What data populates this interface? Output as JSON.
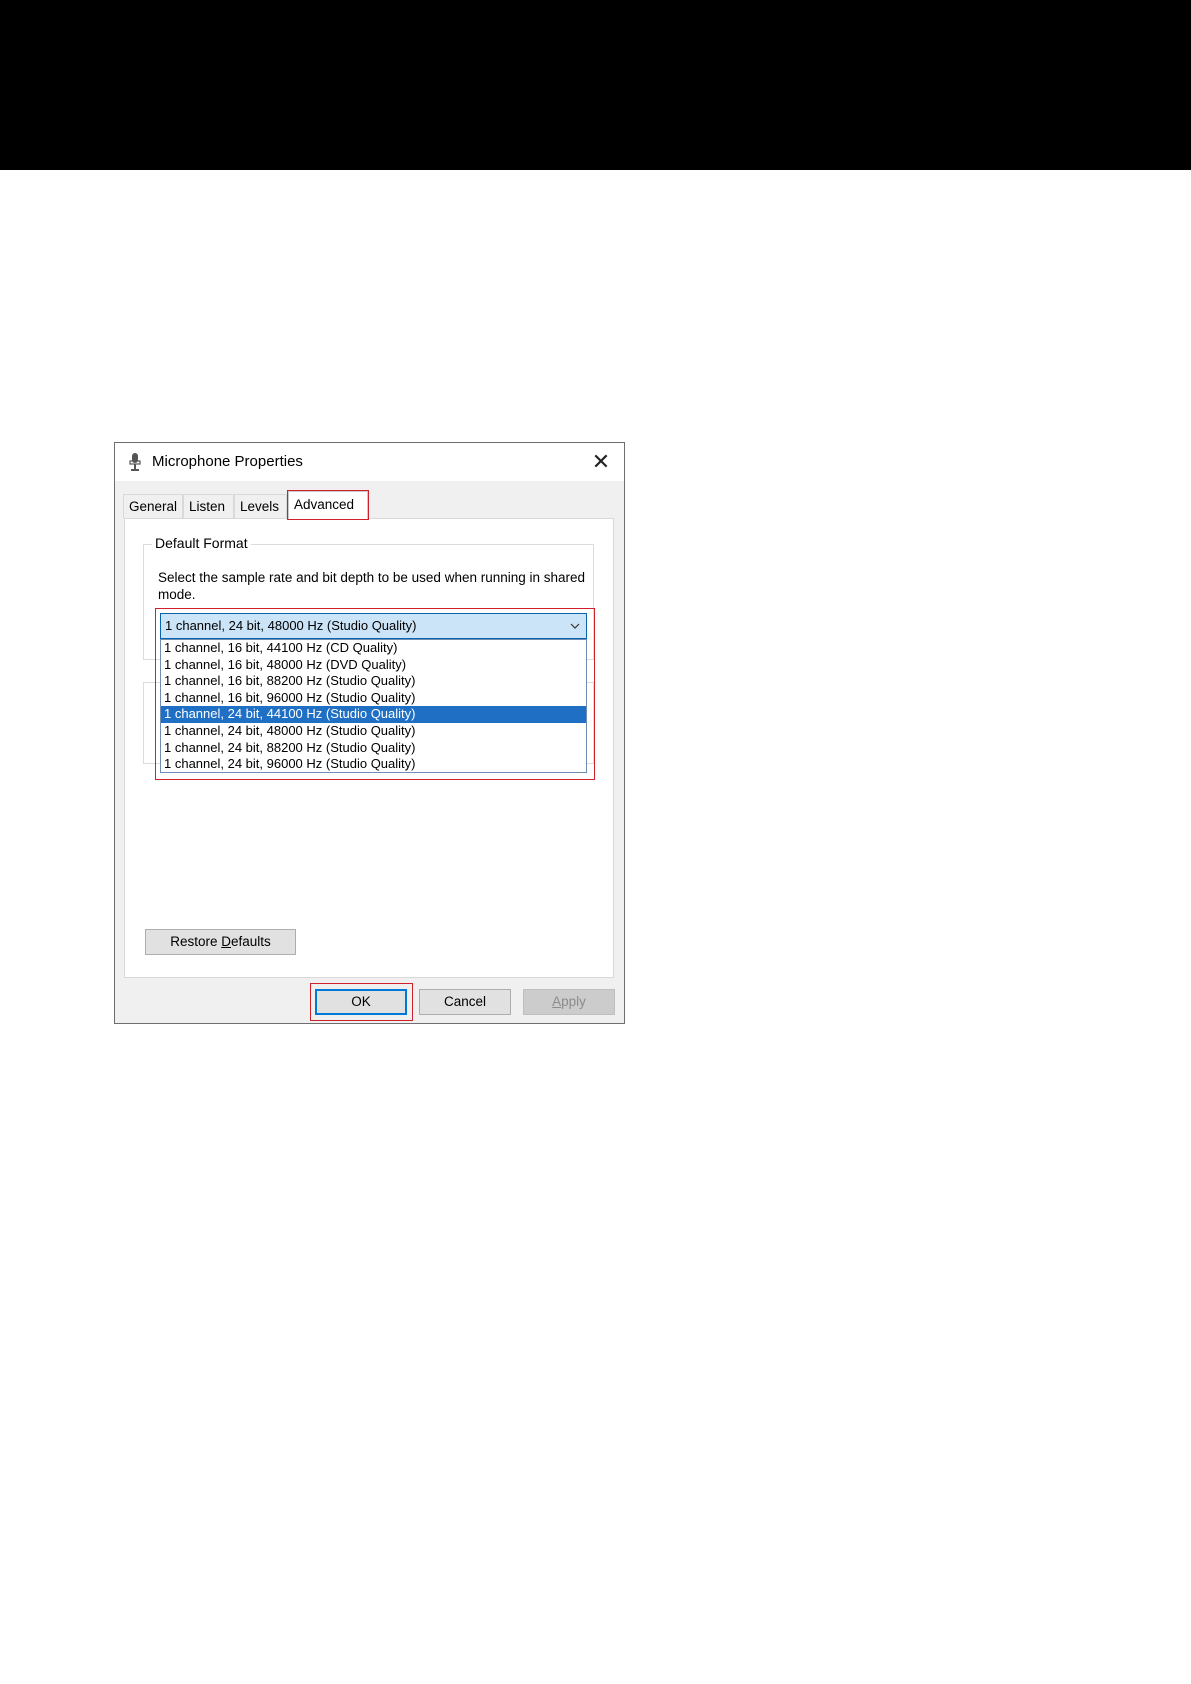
{
  "dialog": {
    "title": "Microphone Properties",
    "close_glyph": "✕"
  },
  "tabs": [
    {
      "label": "General"
    },
    {
      "label": "Listen"
    },
    {
      "label": "Levels"
    },
    {
      "label": "Advanced",
      "active": true
    }
  ],
  "default_format": {
    "group_label": "Default Format",
    "description": "Select the sample rate and bit depth to be used when running in shared mode.",
    "selected_value": "1 channel, 24 bit, 48000 Hz (Studio Quality)",
    "options": [
      "1 channel, 16 bit, 44100 Hz (CD Quality)",
      "1 channel, 16 bit, 48000 Hz (DVD Quality)",
      "1 channel, 16 bit, 88200 Hz (Studio Quality)",
      "1 channel, 16 bit, 96000 Hz (Studio Quality)",
      "1 channel, 24 bit, 44100 Hz (Studio Quality)",
      "1 channel, 24 bit, 48000 Hz (Studio Quality)",
      "1 channel, 24 bit, 88200 Hz (Studio Quality)",
      "1 channel, 24 bit, 96000 Hz (Studio Quality)"
    ],
    "highlighted_option": "1 channel, 24 bit, 44100 Hz (Studio Quality)"
  },
  "buttons": {
    "restore_prefix": "Restore ",
    "restore_accel": "D",
    "restore_suffix": "efaults",
    "ok": "OK",
    "cancel": "Cancel",
    "apply_accel": "A",
    "apply_suffix": "pply"
  },
  "colors": {
    "highlight_border": "#d0202a",
    "selection_blue": "#1f6fc5",
    "focus_blue": "#0078d7"
  },
  "icons": {
    "title": "microphone-icon",
    "close": "close-icon",
    "dropdown": "chevron-down-icon"
  }
}
